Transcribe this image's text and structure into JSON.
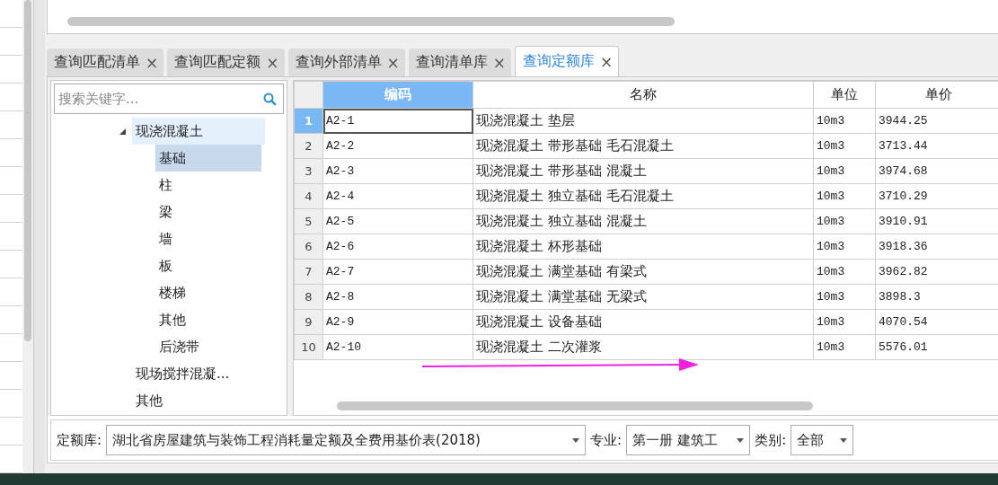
{
  "tabs": [
    {
      "label": "查询匹配清单",
      "close": "×",
      "selected": false
    },
    {
      "label": "查询匹配定额",
      "close": "×",
      "selected": false
    },
    {
      "label": "查询外部清单",
      "close": "×",
      "selected": false
    },
    {
      "label": "查询清单库",
      "close": "×",
      "selected": false
    },
    {
      "label": "查询定额库",
      "close": "×",
      "selected": true
    }
  ],
  "search": {
    "placeholder": "搜索关键字..."
  },
  "tree": [
    {
      "label": "现浇混凝土",
      "expanded": true,
      "highlighted": true,
      "selected": false,
      "children": [
        {
          "label": "基础",
          "selected": true
        },
        {
          "label": "柱",
          "selected": false
        },
        {
          "label": "梁",
          "selected": false
        },
        {
          "label": "墙",
          "selected": false
        },
        {
          "label": "板",
          "selected": false
        },
        {
          "label": "楼梯",
          "selected": false
        },
        {
          "label": "其他",
          "selected": false
        },
        {
          "label": "后浇带",
          "selected": false
        }
      ]
    },
    {
      "label": "现场搅拌混凝...",
      "expanded": false,
      "highlighted": false,
      "selected": false
    },
    {
      "label": "其他",
      "expanded": false,
      "highlighted": false,
      "selected": false
    }
  ],
  "table": {
    "columns": [
      {
        "label": "编码",
        "selected": true
      },
      {
        "label": "名称",
        "selected": false
      },
      {
        "label": "单位",
        "selected": false
      },
      {
        "label": "单价",
        "selected": false
      }
    ],
    "rows": [
      {
        "number": "1",
        "code": "A2-1",
        "name": "现浇混凝土 垫层",
        "unit": "10m3",
        "price": "3944.25",
        "selected": true
      },
      {
        "number": "2",
        "code": "A2-2",
        "name": "现浇混凝土 带形基础 毛石混凝土",
        "unit": "10m3",
        "price": "3713.44",
        "selected": false
      },
      {
        "number": "3",
        "code": "A2-3",
        "name": "现浇混凝土 带形基础 混凝土",
        "unit": "10m3",
        "price": "3974.68",
        "selected": false
      },
      {
        "number": "4",
        "code": "A2-4",
        "name": "现浇混凝土 独立基础 毛石混凝土",
        "unit": "10m3",
        "price": "3710.29",
        "selected": false
      },
      {
        "number": "5",
        "code": "A2-5",
        "name": "现浇混凝土 独立基础 混凝土",
        "unit": "10m3",
        "price": "3910.91",
        "selected": false
      },
      {
        "number": "6",
        "code": "A2-6",
        "name": "现浇混凝土 杯形基础",
        "unit": "10m3",
        "price": "3918.36",
        "selected": false
      },
      {
        "number": "7",
        "code": "A2-7",
        "name": "现浇混凝土 满堂基础 有梁式",
        "unit": "10m3",
        "price": "3962.82",
        "selected": false
      },
      {
        "number": "8",
        "code": "A2-8",
        "name": "现浇混凝土 满堂基础 无梁式",
        "unit": "10m3",
        "price": "3898.3",
        "selected": false
      },
      {
        "number": "9",
        "code": "A2-9",
        "name": "现浇混凝土 设备基础",
        "unit": "10m3",
        "price": "4070.54",
        "selected": false
      },
      {
        "number": "10",
        "code": "A2-10",
        "name": "现浇混凝土 二次灌浆",
        "unit": "10m3",
        "price": "5576.01",
        "selected": false
      }
    ]
  },
  "filters": [
    {
      "label": "定额库:",
      "value": "湖北省房屋建筑与装饰工程消耗量定额及全费用基价表(2018)"
    },
    {
      "label": "专业:",
      "value": "第一册 建筑工"
    },
    {
      "label": "类别:",
      "value": "全部"
    }
  ]
}
